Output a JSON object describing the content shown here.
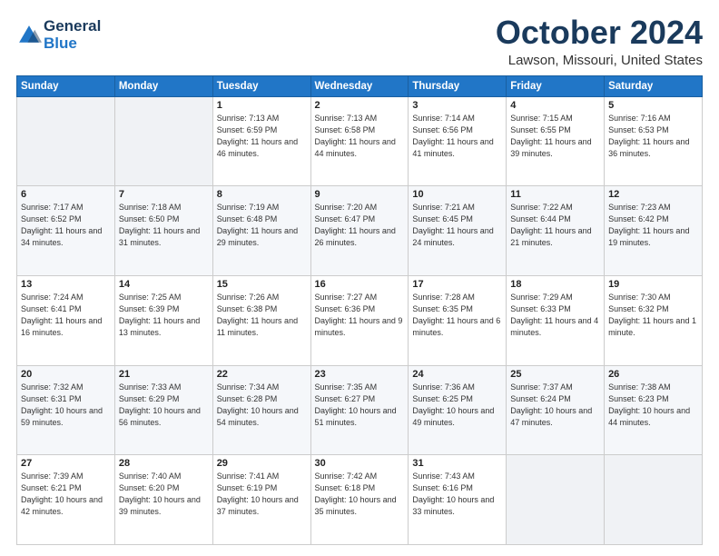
{
  "header": {
    "logo_line1": "General",
    "logo_line2": "Blue",
    "month": "October 2024",
    "location": "Lawson, Missouri, United States"
  },
  "weekdays": [
    "Sunday",
    "Monday",
    "Tuesday",
    "Wednesday",
    "Thursday",
    "Friday",
    "Saturday"
  ],
  "weeks": [
    [
      {
        "day": "",
        "info": ""
      },
      {
        "day": "",
        "info": ""
      },
      {
        "day": "1",
        "info": "Sunrise: 7:13 AM\nSunset: 6:59 PM\nDaylight: 11 hours and 46 minutes."
      },
      {
        "day": "2",
        "info": "Sunrise: 7:13 AM\nSunset: 6:58 PM\nDaylight: 11 hours and 44 minutes."
      },
      {
        "day": "3",
        "info": "Sunrise: 7:14 AM\nSunset: 6:56 PM\nDaylight: 11 hours and 41 minutes."
      },
      {
        "day": "4",
        "info": "Sunrise: 7:15 AM\nSunset: 6:55 PM\nDaylight: 11 hours and 39 minutes."
      },
      {
        "day": "5",
        "info": "Sunrise: 7:16 AM\nSunset: 6:53 PM\nDaylight: 11 hours and 36 minutes."
      }
    ],
    [
      {
        "day": "6",
        "info": "Sunrise: 7:17 AM\nSunset: 6:52 PM\nDaylight: 11 hours and 34 minutes."
      },
      {
        "day": "7",
        "info": "Sunrise: 7:18 AM\nSunset: 6:50 PM\nDaylight: 11 hours and 31 minutes."
      },
      {
        "day": "8",
        "info": "Sunrise: 7:19 AM\nSunset: 6:48 PM\nDaylight: 11 hours and 29 minutes."
      },
      {
        "day": "9",
        "info": "Sunrise: 7:20 AM\nSunset: 6:47 PM\nDaylight: 11 hours and 26 minutes."
      },
      {
        "day": "10",
        "info": "Sunrise: 7:21 AM\nSunset: 6:45 PM\nDaylight: 11 hours and 24 minutes."
      },
      {
        "day": "11",
        "info": "Sunrise: 7:22 AM\nSunset: 6:44 PM\nDaylight: 11 hours and 21 minutes."
      },
      {
        "day": "12",
        "info": "Sunrise: 7:23 AM\nSunset: 6:42 PM\nDaylight: 11 hours and 19 minutes."
      }
    ],
    [
      {
        "day": "13",
        "info": "Sunrise: 7:24 AM\nSunset: 6:41 PM\nDaylight: 11 hours and 16 minutes."
      },
      {
        "day": "14",
        "info": "Sunrise: 7:25 AM\nSunset: 6:39 PM\nDaylight: 11 hours and 13 minutes."
      },
      {
        "day": "15",
        "info": "Sunrise: 7:26 AM\nSunset: 6:38 PM\nDaylight: 11 hours and 11 minutes."
      },
      {
        "day": "16",
        "info": "Sunrise: 7:27 AM\nSunset: 6:36 PM\nDaylight: 11 hours and 9 minutes."
      },
      {
        "day": "17",
        "info": "Sunrise: 7:28 AM\nSunset: 6:35 PM\nDaylight: 11 hours and 6 minutes."
      },
      {
        "day": "18",
        "info": "Sunrise: 7:29 AM\nSunset: 6:33 PM\nDaylight: 11 hours and 4 minutes."
      },
      {
        "day": "19",
        "info": "Sunrise: 7:30 AM\nSunset: 6:32 PM\nDaylight: 11 hours and 1 minute."
      }
    ],
    [
      {
        "day": "20",
        "info": "Sunrise: 7:32 AM\nSunset: 6:31 PM\nDaylight: 10 hours and 59 minutes."
      },
      {
        "day": "21",
        "info": "Sunrise: 7:33 AM\nSunset: 6:29 PM\nDaylight: 10 hours and 56 minutes."
      },
      {
        "day": "22",
        "info": "Sunrise: 7:34 AM\nSunset: 6:28 PM\nDaylight: 10 hours and 54 minutes."
      },
      {
        "day": "23",
        "info": "Sunrise: 7:35 AM\nSunset: 6:27 PM\nDaylight: 10 hours and 51 minutes."
      },
      {
        "day": "24",
        "info": "Sunrise: 7:36 AM\nSunset: 6:25 PM\nDaylight: 10 hours and 49 minutes."
      },
      {
        "day": "25",
        "info": "Sunrise: 7:37 AM\nSunset: 6:24 PM\nDaylight: 10 hours and 47 minutes."
      },
      {
        "day": "26",
        "info": "Sunrise: 7:38 AM\nSunset: 6:23 PM\nDaylight: 10 hours and 44 minutes."
      }
    ],
    [
      {
        "day": "27",
        "info": "Sunrise: 7:39 AM\nSunset: 6:21 PM\nDaylight: 10 hours and 42 minutes."
      },
      {
        "day": "28",
        "info": "Sunrise: 7:40 AM\nSunset: 6:20 PM\nDaylight: 10 hours and 39 minutes."
      },
      {
        "day": "29",
        "info": "Sunrise: 7:41 AM\nSunset: 6:19 PM\nDaylight: 10 hours and 37 minutes."
      },
      {
        "day": "30",
        "info": "Sunrise: 7:42 AM\nSunset: 6:18 PM\nDaylight: 10 hours and 35 minutes."
      },
      {
        "day": "31",
        "info": "Sunrise: 7:43 AM\nSunset: 6:16 PM\nDaylight: 10 hours and 33 minutes."
      },
      {
        "day": "",
        "info": ""
      },
      {
        "day": "",
        "info": ""
      }
    ]
  ]
}
